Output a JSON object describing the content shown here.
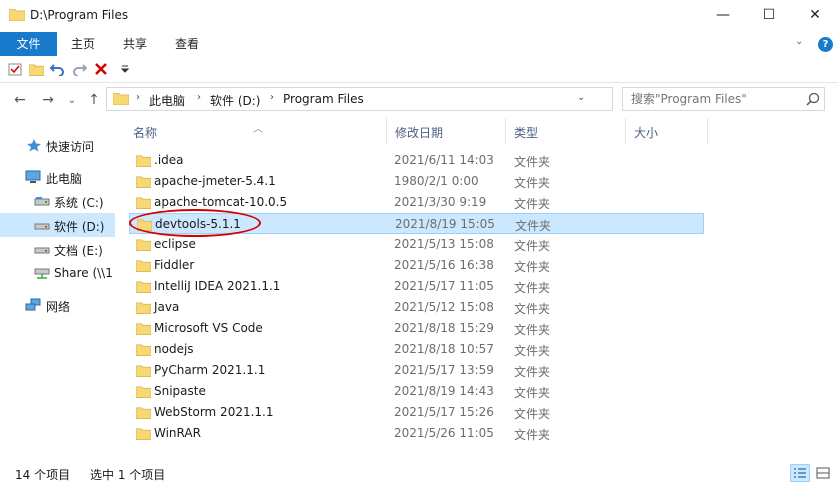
{
  "window": {
    "title": "D:\\Program Files",
    "minimize": "—",
    "maximize": "☐",
    "close": "✕"
  },
  "ribbon": {
    "tabs": [
      "文件",
      "主页",
      "共享",
      "查看"
    ],
    "expand": "⌄",
    "help": "?"
  },
  "nav": {
    "back": "←",
    "forward": "→",
    "recent": "⌄",
    "up": "↑"
  },
  "address": {
    "crumbs": [
      "此电脑",
      "软件 (D:)",
      "Program Files"
    ],
    "sep": "›",
    "dropdown": "⌄",
    "refresh": "↻"
  },
  "search": {
    "placeholder": "搜索\"Program Files\""
  },
  "sidebar": {
    "items": [
      {
        "label": "快速访问",
        "icon": "star-icon"
      },
      {
        "label": "此电脑",
        "icon": "pc-icon"
      },
      {
        "label": "系统 (C:)",
        "icon": "drive-icon"
      },
      {
        "label": "软件 (D:)",
        "icon": "drive-icon",
        "selected": true
      },
      {
        "label": "文档 (E:)",
        "icon": "drive-icon"
      },
      {
        "label": "Share (\\\\1",
        "icon": "network-drive-icon"
      },
      {
        "label": "网络",
        "icon": "network-icon"
      }
    ]
  },
  "columns": {
    "name": "名称",
    "date": "修改日期",
    "type": "类型",
    "size": "大小"
  },
  "files": [
    {
      "name": ".idea",
      "date": "2021/6/11 14:03",
      "type": "文件夹"
    },
    {
      "name": "apache-jmeter-5.4.1",
      "date": "1980/2/1 0:00",
      "type": "文件夹"
    },
    {
      "name": "apache-tomcat-10.0.5",
      "date": "2021/3/30 9:19",
      "type": "文件夹"
    },
    {
      "name": "devtools-5.1.1",
      "date": "2021/8/19 15:05",
      "type": "文件夹",
      "selected": true
    },
    {
      "name": "eclipse",
      "date": "2021/5/13 15:08",
      "type": "文件夹"
    },
    {
      "name": "Fiddler",
      "date": "2021/5/16 16:38",
      "type": "文件夹"
    },
    {
      "name": "IntelliJ IDEA 2021.1.1",
      "date": "2021/5/17 11:05",
      "type": "文件夹"
    },
    {
      "name": "Java",
      "date": "2021/5/12 15:08",
      "type": "文件夹"
    },
    {
      "name": "Microsoft VS Code",
      "date": "2021/8/18 15:29",
      "type": "文件夹"
    },
    {
      "name": "nodejs",
      "date": "2021/8/18 10:57",
      "type": "文件夹"
    },
    {
      "name": "PyCharm 2021.1.1",
      "date": "2021/5/17 13:59",
      "type": "文件夹"
    },
    {
      "name": "Snipaste",
      "date": "2021/8/19 14:43",
      "type": "文件夹"
    },
    {
      "name": "WebStorm 2021.1.1",
      "date": "2021/5/17 15:26",
      "type": "文件夹"
    },
    {
      "name": "WinRAR",
      "date": "2021/5/26 11:05",
      "type": "文件夹"
    }
  ],
  "status": {
    "count": "14 个项目",
    "selected": "选中 1 个项目"
  },
  "colors": {
    "accent": "#1979ca",
    "selection": "#cce8ff",
    "selection_border": "#99d1ff",
    "folder": "#f8d775",
    "annotation": "#d40000"
  }
}
